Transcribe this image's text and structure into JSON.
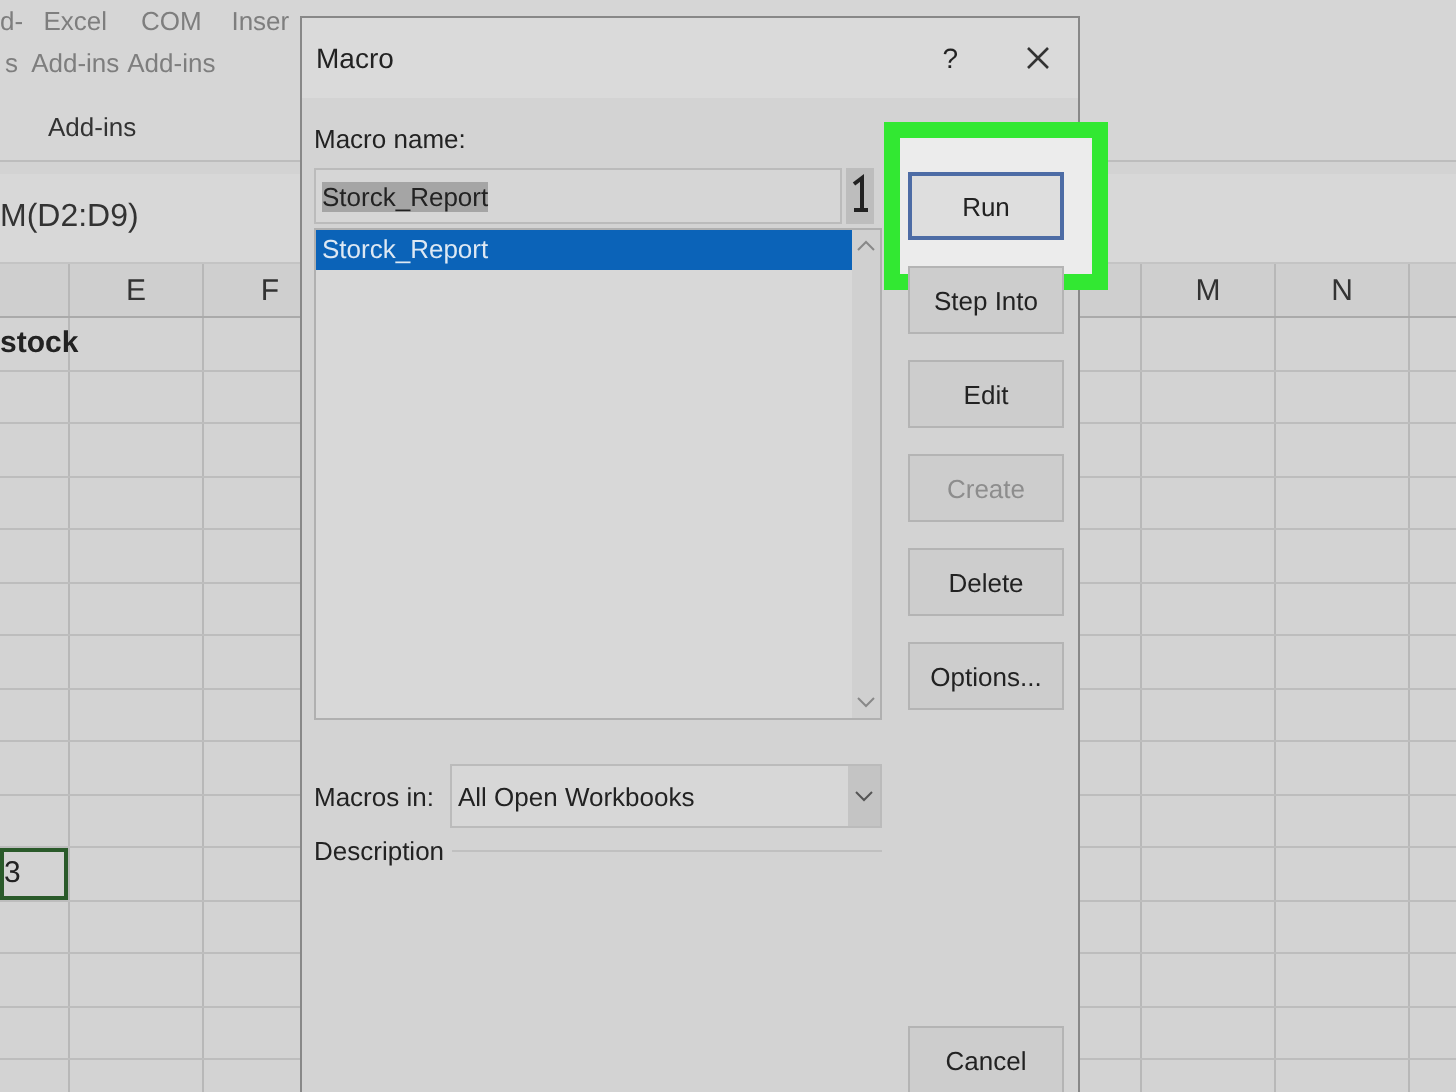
{
  "ribbon": {
    "buttons": [
      {
        "lines": [
          "d-",
          "s"
        ]
      },
      {
        "lines": [
          "Excel",
          "Add-ins"
        ]
      },
      {
        "lines": [
          "COM",
          "Add-ins"
        ]
      },
      {
        "lines": [
          "Inser"
        ]
      }
    ],
    "group_label": "Add-ins"
  },
  "formula_bar": {
    "text": "M(D2:D9)"
  },
  "sheet": {
    "left_columns": [
      "E",
      "F"
    ],
    "right_columns": [
      "M",
      "N"
    ],
    "cells": [
      {
        "text": "stock",
        "kind": "header",
        "selected": false
      },
      {
        "text": "3",
        "kind": "value",
        "selected": true
      }
    ]
  },
  "dialog": {
    "title": "Macro",
    "help": "?",
    "macro_name_label": "Macro name:",
    "macro_name_value": "Storck_Report",
    "macros": [
      {
        "name": "Storck_Report",
        "selected": true
      }
    ],
    "buttons": [
      {
        "label": "Run",
        "disabled": false,
        "highlighted": true,
        "kind": "action"
      },
      {
        "label": "Step Into",
        "disabled": false,
        "highlighted": false,
        "kind": "action"
      },
      {
        "label": "Edit",
        "disabled": false,
        "highlighted": false,
        "kind": "action"
      },
      {
        "label": "Create",
        "disabled": true,
        "highlighted": false,
        "kind": "action"
      },
      {
        "label": "Delete",
        "disabled": false,
        "highlighted": false,
        "kind": "action"
      },
      {
        "label": "Options...",
        "disabled": false,
        "highlighted": false,
        "kind": "action"
      },
      {
        "label": "Cancel",
        "disabled": false,
        "highlighted": false,
        "kind": "cancel"
      }
    ],
    "macros_in_label": "Macros in:",
    "macros_in_value": "All Open Workbooks",
    "description_label": "Description"
  }
}
